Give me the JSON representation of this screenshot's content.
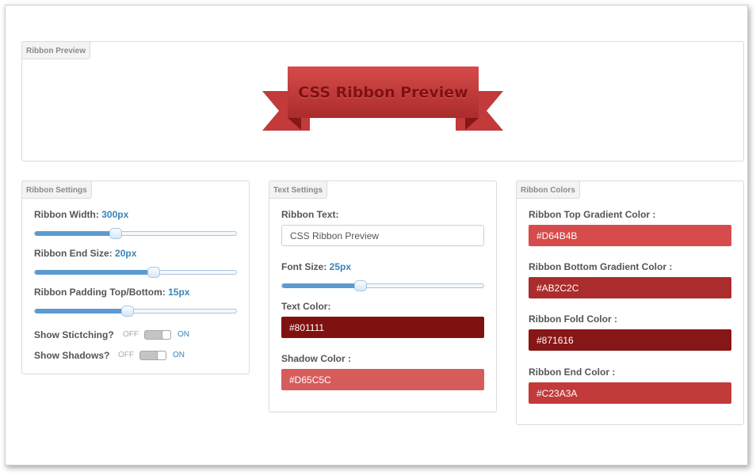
{
  "preview": {
    "tab_label": "Ribbon Preview",
    "ribbon_text": "CSS Ribbon Preview"
  },
  "ribbon_settings": {
    "tab_label": "Ribbon Settings",
    "width_label": "Ribbon Width:",
    "width_value": "300px",
    "width_slider_fraction": 0.4,
    "end_size_label": "Ribbon End Size:",
    "end_size_value": "20px",
    "end_size_slider_fraction": 0.59,
    "padding_label": "Ribbon Padding Top/Bottom:",
    "padding_value": "15px",
    "padding_slider_fraction": 0.46,
    "stitching_label": "Show Stictching?",
    "shadows_label": "Show Shadows?",
    "toggle_off": "OFF",
    "toggle_on": "ON"
  },
  "text_settings": {
    "tab_label": "Text Settings",
    "ribbon_text_label": "Ribbon Text:",
    "ribbon_text_value": "CSS Ribbon Preview",
    "font_size_label": "Font Size:",
    "font_size_value": "25px",
    "font_size_slider_fraction": 0.39,
    "text_color_label": "Text Color:",
    "text_color_value": "#801111",
    "shadow_color_label": "Shadow Color :",
    "shadow_color_value": "#D65C5C"
  },
  "ribbon_colors": {
    "tab_label": "Ribbon Colors",
    "top_gradient_label": "Ribbon Top Gradient Color :",
    "top_gradient_value": "#D64B4B",
    "bottom_gradient_label": "Ribbon Bottom Gradient Color :",
    "bottom_gradient_value": "#AB2C2C",
    "fold_label": "Ribbon Fold Color :",
    "fold_value": "#871616",
    "end_label": "Ribbon End Color :",
    "end_value": "#C23A3A"
  },
  "colors": {
    "accent": "#3a84b5",
    "slider_fill": "#5b9bd1",
    "shadow_color_box": "#d65c5c"
  }
}
